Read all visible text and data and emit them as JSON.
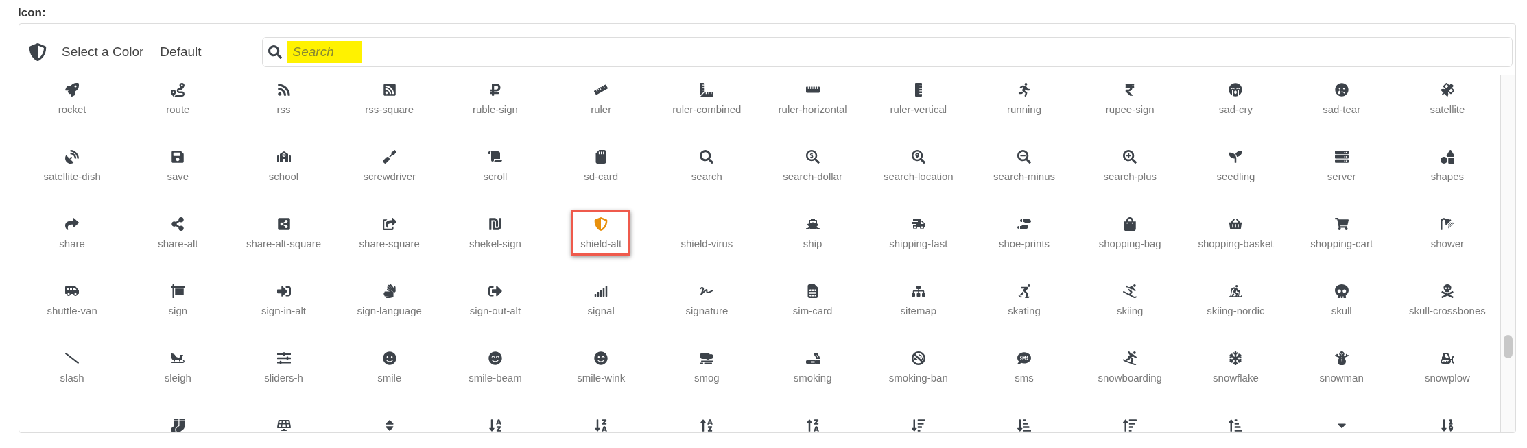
{
  "field_label": "Icon:",
  "header": {
    "color_picker": "Select a Color",
    "default_option": "Default"
  },
  "search": {
    "placeholder": "Search"
  },
  "icons": [
    {
      "label": "rocket",
      "selected": false
    },
    {
      "label": "route",
      "selected": false
    },
    {
      "label": "rss",
      "selected": false
    },
    {
      "label": "rss-square",
      "selected": false
    },
    {
      "label": "ruble-sign",
      "selected": false
    },
    {
      "label": "ruler",
      "selected": false
    },
    {
      "label": "ruler-combined",
      "selected": false
    },
    {
      "label": "ruler-horizontal",
      "selected": false
    },
    {
      "label": "ruler-vertical",
      "selected": false
    },
    {
      "label": "running",
      "selected": false
    },
    {
      "label": "rupee-sign",
      "selected": false
    },
    {
      "label": "sad-cry",
      "selected": false
    },
    {
      "label": "sad-tear",
      "selected": false
    },
    {
      "label": "satellite",
      "selected": false
    },
    {
      "label": "satellite-dish",
      "selected": false
    },
    {
      "label": "save",
      "selected": false
    },
    {
      "label": "school",
      "selected": false
    },
    {
      "label": "screwdriver",
      "selected": false
    },
    {
      "label": "scroll",
      "selected": false
    },
    {
      "label": "sd-card",
      "selected": false
    },
    {
      "label": "search",
      "selected": false
    },
    {
      "label": "search-dollar",
      "selected": false
    },
    {
      "label": "search-location",
      "selected": false
    },
    {
      "label": "search-minus",
      "selected": false
    },
    {
      "label": "search-plus",
      "selected": false
    },
    {
      "label": "seedling",
      "selected": false
    },
    {
      "label": "server",
      "selected": false
    },
    {
      "label": "shapes",
      "selected": false
    },
    {
      "label": "share",
      "selected": false
    },
    {
      "label": "share-alt",
      "selected": false
    },
    {
      "label": "share-alt-square",
      "selected": false
    },
    {
      "label": "share-square",
      "selected": false
    },
    {
      "label": "shekel-sign",
      "selected": false
    },
    {
      "label": "shield-alt",
      "selected": true
    },
    {
      "label": "shield-virus",
      "selected": false
    },
    {
      "label": "ship",
      "selected": false
    },
    {
      "label": "shipping-fast",
      "selected": false
    },
    {
      "label": "shoe-prints",
      "selected": false
    },
    {
      "label": "shopping-bag",
      "selected": false
    },
    {
      "label": "shopping-basket",
      "selected": false
    },
    {
      "label": "shopping-cart",
      "selected": false
    },
    {
      "label": "shower",
      "selected": false
    },
    {
      "label": "shuttle-van",
      "selected": false
    },
    {
      "label": "sign",
      "selected": false
    },
    {
      "label": "sign-in-alt",
      "selected": false
    },
    {
      "label": "sign-language",
      "selected": false
    },
    {
      "label": "sign-out-alt",
      "selected": false
    },
    {
      "label": "signal",
      "selected": false
    },
    {
      "label": "signature",
      "selected": false
    },
    {
      "label": "sim-card",
      "selected": false
    },
    {
      "label": "sitemap",
      "selected": false
    },
    {
      "label": "skating",
      "selected": false
    },
    {
      "label": "skiing",
      "selected": false
    },
    {
      "label": "skiing-nordic",
      "selected": false
    },
    {
      "label": "skull",
      "selected": false
    },
    {
      "label": "skull-crossbones",
      "selected": false
    },
    {
      "label": "slash",
      "selected": false
    },
    {
      "label": "sleigh",
      "selected": false
    },
    {
      "label": "sliders-h",
      "selected": false
    },
    {
      "label": "smile",
      "selected": false
    },
    {
      "label": "smile-beam",
      "selected": false
    },
    {
      "label": "smile-wink",
      "selected": false
    },
    {
      "label": "smog",
      "selected": false
    },
    {
      "label": "smoking",
      "selected": false
    },
    {
      "label": "smoking-ban",
      "selected": false
    },
    {
      "label": "sms",
      "selected": false
    },
    {
      "label": "snowboarding",
      "selected": false
    },
    {
      "label": "snowflake",
      "selected": false
    },
    {
      "label": "snowman",
      "selected": false
    },
    {
      "label": "snowplow",
      "selected": false
    },
    {
      "selected": false
    },
    {
      "selected": false
    },
    {
      "selected": false
    },
    {
      "selected": false
    },
    {
      "selected": false
    },
    {
      "selected": false
    },
    {
      "selected": false
    },
    {
      "selected": false
    },
    {
      "selected": false
    },
    {
      "selected": false
    },
    {
      "selected": false
    },
    {
      "selected": false
    },
    {
      "selected": false
    },
    {
      "selected": false
    }
  ]
}
